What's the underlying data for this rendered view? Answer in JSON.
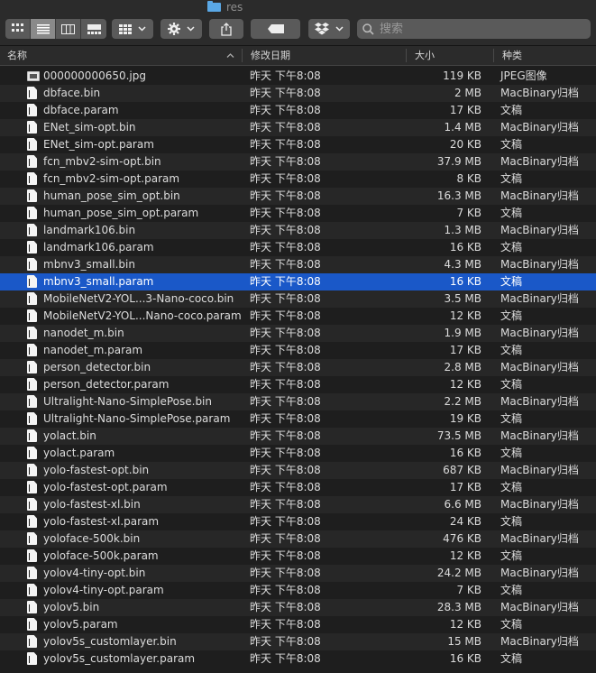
{
  "window": {
    "title": "res"
  },
  "toolbar": {
    "view_modes": [
      {
        "name": "icon-view-icon",
        "active": false
      },
      {
        "name": "list-view-icon",
        "active": true
      },
      {
        "name": "column-view-icon",
        "active": false
      },
      {
        "name": "gallery-view-icon",
        "active": false
      }
    ],
    "search_placeholder": "搜索"
  },
  "columns": {
    "name": "名称",
    "date": "修改日期",
    "size": "大小",
    "kind": "种类"
  },
  "files": [
    {
      "name": "000000000650.jpg",
      "date": "昨天 下午8:08",
      "size": "119 KB",
      "kind": "JPEG图像",
      "icon": "image-file-icon"
    },
    {
      "name": "dbface.bin",
      "date": "昨天 下午8:08",
      "size": "2 MB",
      "kind": "MacBinary归档",
      "icon": "document-icon"
    },
    {
      "name": "dbface.param",
      "date": "昨天 下午8:08",
      "size": "17 KB",
      "kind": "文稿",
      "icon": "document-icon"
    },
    {
      "name": "ENet_sim-opt.bin",
      "date": "昨天 下午8:08",
      "size": "1.4 MB",
      "kind": "MacBinary归档",
      "icon": "document-icon"
    },
    {
      "name": "ENet_sim-opt.param",
      "date": "昨天 下午8:08",
      "size": "20 KB",
      "kind": "文稿",
      "icon": "document-icon"
    },
    {
      "name": "fcn_mbv2-sim-opt.bin",
      "date": "昨天 下午8:08",
      "size": "37.9 MB",
      "kind": "MacBinary归档",
      "icon": "document-icon"
    },
    {
      "name": "fcn_mbv2-sim-opt.param",
      "date": "昨天 下午8:08",
      "size": "8 KB",
      "kind": "文稿",
      "icon": "document-icon"
    },
    {
      "name": "human_pose_sim_opt.bin",
      "date": "昨天 下午8:08",
      "size": "16.3 MB",
      "kind": "MacBinary归档",
      "icon": "document-icon"
    },
    {
      "name": "human_pose_sim_opt.param",
      "date": "昨天 下午8:08",
      "size": "7 KB",
      "kind": "文稿",
      "icon": "document-icon"
    },
    {
      "name": "landmark106.bin",
      "date": "昨天 下午8:08",
      "size": "1.3 MB",
      "kind": "MacBinary归档",
      "icon": "document-icon"
    },
    {
      "name": "landmark106.param",
      "date": "昨天 下午8:08",
      "size": "16 KB",
      "kind": "文稿",
      "icon": "document-icon"
    },
    {
      "name": "mbnv3_small.bin",
      "date": "昨天 下午8:08",
      "size": "4.3 MB",
      "kind": "MacBinary归档",
      "icon": "document-icon"
    },
    {
      "name": "mbnv3_small.param",
      "date": "昨天 下午8:08",
      "size": "16 KB",
      "kind": "文稿",
      "icon": "document-icon",
      "selected": true
    },
    {
      "name": "MobileNetV2-YOL...3-Nano-coco.bin",
      "date": "昨天 下午8:08",
      "size": "3.5 MB",
      "kind": "MacBinary归档",
      "icon": "document-icon"
    },
    {
      "name": "MobileNetV2-YOL...Nano-coco.param",
      "date": "昨天 下午8:08",
      "size": "12 KB",
      "kind": "文稿",
      "icon": "document-icon"
    },
    {
      "name": "nanodet_m.bin",
      "date": "昨天 下午8:08",
      "size": "1.9 MB",
      "kind": "MacBinary归档",
      "icon": "document-icon"
    },
    {
      "name": "nanodet_m.param",
      "date": "昨天 下午8:08",
      "size": "17 KB",
      "kind": "文稿",
      "icon": "document-icon"
    },
    {
      "name": "person_detector.bin",
      "date": "昨天 下午8:08",
      "size": "2.8 MB",
      "kind": "MacBinary归档",
      "icon": "document-icon"
    },
    {
      "name": "person_detector.param",
      "date": "昨天 下午8:08",
      "size": "12 KB",
      "kind": "文稿",
      "icon": "document-icon"
    },
    {
      "name": "Ultralight-Nano-SimplePose.bin",
      "date": "昨天 下午8:08",
      "size": "2.2 MB",
      "kind": "MacBinary归档",
      "icon": "document-icon"
    },
    {
      "name": "Ultralight-Nano-SimplePose.param",
      "date": "昨天 下午8:08",
      "size": "19 KB",
      "kind": "文稿",
      "icon": "document-icon"
    },
    {
      "name": "yolact.bin",
      "date": "昨天 下午8:08",
      "size": "73.5 MB",
      "kind": "MacBinary归档",
      "icon": "document-icon"
    },
    {
      "name": "yolact.param",
      "date": "昨天 下午8:08",
      "size": "16 KB",
      "kind": "文稿",
      "icon": "document-icon"
    },
    {
      "name": "yolo-fastest-opt.bin",
      "date": "昨天 下午8:08",
      "size": "687 KB",
      "kind": "MacBinary归档",
      "icon": "document-icon"
    },
    {
      "name": "yolo-fastest-opt.param",
      "date": "昨天 下午8:08",
      "size": "17 KB",
      "kind": "文稿",
      "icon": "document-icon"
    },
    {
      "name": "yolo-fastest-xl.bin",
      "date": "昨天 下午8:08",
      "size": "6.6 MB",
      "kind": "MacBinary归档",
      "icon": "document-icon"
    },
    {
      "name": "yolo-fastest-xl.param",
      "date": "昨天 下午8:08",
      "size": "24 KB",
      "kind": "文稿",
      "icon": "document-icon"
    },
    {
      "name": "yoloface-500k.bin",
      "date": "昨天 下午8:08",
      "size": "476 KB",
      "kind": "MacBinary归档",
      "icon": "document-icon"
    },
    {
      "name": "yoloface-500k.param",
      "date": "昨天 下午8:08",
      "size": "12 KB",
      "kind": "文稿",
      "icon": "document-icon"
    },
    {
      "name": "yolov4-tiny-opt.bin",
      "date": "昨天 下午8:08",
      "size": "24.2 MB",
      "kind": "MacBinary归档",
      "icon": "document-icon"
    },
    {
      "name": "yolov4-tiny-opt.param",
      "date": "昨天 下午8:08",
      "size": "7 KB",
      "kind": "文稿",
      "icon": "document-icon"
    },
    {
      "name": "yolov5.bin",
      "date": "昨天 下午8:08",
      "size": "28.3 MB",
      "kind": "MacBinary归档",
      "icon": "document-icon"
    },
    {
      "name": "yolov5.param",
      "date": "昨天 下午8:08",
      "size": "12 KB",
      "kind": "文稿",
      "icon": "document-icon"
    },
    {
      "name": "yolov5s_customlayer.bin",
      "date": "昨天 下午8:08",
      "size": "15 MB",
      "kind": "MacBinary归档",
      "icon": "document-icon"
    },
    {
      "name": "yolov5s_customlayer.param",
      "date": "昨天 下午8:08",
      "size": "16 KB",
      "kind": "文稿",
      "icon": "document-icon"
    }
  ],
  "colors": {
    "background": "#1e1e1e",
    "alt_row": "#272727",
    "selection": "#1a58c8",
    "toolbar": "#2b2b2b",
    "button": "#5a5a5a",
    "folder_accent": "#5aa8e6"
  }
}
